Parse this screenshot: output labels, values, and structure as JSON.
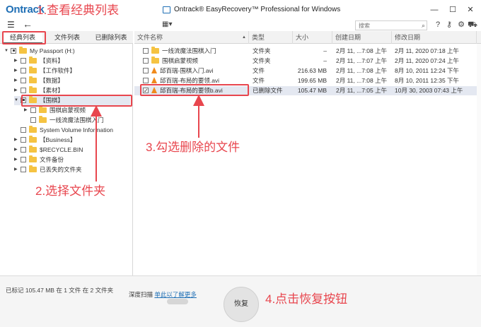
{
  "app": {
    "logo": "Ontrack",
    "title": "Ontrack® EasyRecovery™ Professional for Windows"
  },
  "window_controls": {
    "minimize": "—",
    "maximize": "☐",
    "close": "✕"
  },
  "toolbar": {
    "menu_icon": "hamburger-icon",
    "back_icon": "back-arrow-icon",
    "view_icon": "grid-view-icon",
    "search_placeholder": "搜索",
    "search_icon": "magnifier-icon",
    "help_icon": "question-icon",
    "key_icon": "key-icon",
    "settings_icon": "gear-icon",
    "cart_icon": "cart-icon"
  },
  "tabs": [
    "经典列表",
    "文件列表",
    "已删除列表"
  ],
  "tree": [
    {
      "label": "My Passport (H:)",
      "check": "dot"
    },
    {
      "label": "【资料】",
      "check": "none"
    },
    {
      "label": "【工作软件】",
      "check": "none"
    },
    {
      "label": "【数据】",
      "check": "none"
    },
    {
      "label": "【素材】",
      "check": "none"
    },
    {
      "label": "【围棋】",
      "check": "dot"
    },
    {
      "label": "围棋启蒙视频",
      "check": "none"
    },
    {
      "label": "一线流魔法围棋入门",
      "check": "none"
    },
    {
      "label": "System Volume Information",
      "check": "none"
    },
    {
      "label": "【Business】",
      "check": "none"
    },
    {
      "label": "$RECYCLE.BIN",
      "check": "none"
    },
    {
      "label": "文件备份",
      "check": "none"
    },
    {
      "label": "已丢失的文件夹",
      "check": "none"
    }
  ],
  "columns": [
    "文件名称",
    "类型",
    "大小",
    "创建日期",
    "修改日期"
  ],
  "files": [
    {
      "name": "一线流魔法围棋入门",
      "type": "文件夹",
      "size": "–",
      "created": "2月 11, ...7:08 上午",
      "modified": "2月 11, 2020 07:18 上午",
      "icon": "folder"
    },
    {
      "name": "围棋启蒙视频",
      "type": "文件夹",
      "size": "–",
      "created": "2月 11, ...7:07 上午",
      "modified": "2月 11, 2020 07:24 上午",
      "icon": "folder"
    },
    {
      "name": "邱百瑞-围棋入门.avi",
      "type": "文件",
      "size": "216.63 MB",
      "created": "2月 11, ...7:08 上午",
      "modified": "8月 10, 2011 12:24 下午",
      "icon": "vlc"
    },
    {
      "name": "邱百瑞-布局的要领.avi",
      "type": "文件",
      "size": "199.65 MB",
      "created": "2月 11, ...7:08 上午",
      "modified": "8月 10, 2011 12:35 下午",
      "icon": "vlc"
    },
    {
      "name": "邱百瑞-布局的要领b.avi",
      "type": "已删除文件",
      "size": "105.47 MB",
      "created": "2月 11, ...7:05 上午",
      "modified": "10月 30, 2003 07:43 上午",
      "icon": "vlc"
    }
  ],
  "status": {
    "marked": "已标记 105.47 MB 在 1 文件 在 2 文件夹",
    "deep_scan_label": "深度扫描",
    "deep_scan_link": "单此以了解更多",
    "recover_button": "恢复"
  },
  "annotations": {
    "step1": "1.查看经典列表",
    "step2": "2.选择文件夹",
    "step3": "3.勾选删除的文件",
    "step4": "4.点击恢复按钮",
    "color": "#e8464e"
  }
}
